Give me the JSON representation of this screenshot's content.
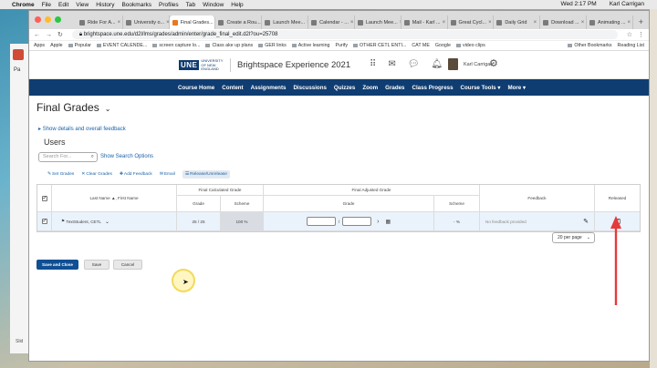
{
  "menubar": {
    "app": "Chrome",
    "items": [
      "File",
      "Edit",
      "View",
      "History",
      "Bookmarks",
      "Profiles",
      "Tab",
      "Window",
      "Help"
    ],
    "clock": "Wed 2:17 PM",
    "user": "Karl Carrigan"
  },
  "tabs": [
    {
      "label": "Ride For A...",
      "active": false
    },
    {
      "label": "University o...",
      "active": false
    },
    {
      "label": "Final Grades...",
      "active": true
    },
    {
      "label": "Create a Rou...",
      "active": false
    },
    {
      "label": "Launch Mee...",
      "active": false
    },
    {
      "label": "Calendar - ...",
      "active": false
    },
    {
      "label": "Launch Mee...",
      "active": false
    },
    {
      "label": "Mail - Karl ...",
      "active": false
    },
    {
      "label": "Great Cycl...",
      "active": false
    },
    {
      "label": "Daily Grid",
      "active": false
    },
    {
      "label": "Download ...",
      "active": false
    },
    {
      "label": "Animating ...",
      "active": false
    }
  ],
  "address": "brightspace.une.edu/d2l/lms/grades/admin/enter/grade_final_edit.d2l?ou=25708",
  "bookmarks": [
    "Apps",
    "Apple",
    "Popular",
    "EVENT CALENDE...",
    "screen capture lo...",
    "Class ake up plans",
    "GER links",
    "Active learning",
    "Purify",
    "OTHER CETL ENTI...",
    "CAT ME",
    "Google",
    "video clips"
  ],
  "bookmarks_right": [
    "Other Bookmarks",
    "Reading List"
  ],
  "site": {
    "logo_text": "UNE",
    "logo_sub": "UNIVERSITY OF NEW ENGLAND",
    "title": "Brightspace Experience 2021",
    "user": "Karl Carrigan"
  },
  "nav": [
    "Course Home",
    "Content",
    "Assignments",
    "Discussions",
    "Quizzes",
    "Zoom",
    "Grades",
    "Class Progress",
    "Course Tools ▾",
    "More ▾"
  ],
  "page": {
    "title": "Final Grades",
    "details_link": "Show details and overall feedback",
    "section": "Users",
    "search_placeholder": "Search For...",
    "search_options": "Show Search Options"
  },
  "actions": [
    "Set Grades",
    "Clear Grades",
    "Add Feedback",
    "Email",
    "Release/Unrelease"
  ],
  "table": {
    "headers": {
      "name": "Last Name ▲, First Name",
      "calc": "Final Calculated Grade",
      "grade": "Grade",
      "scheme": "Scheme",
      "adjusted": "Final Adjusted Grade",
      "adj_grade": "Grade",
      "adj_scheme": "Scheme",
      "feedback": "Feedback",
      "released": "Released"
    },
    "row": {
      "name": "TextStudent, CETL",
      "calc_grade": "25 / 25",
      "calc_scheme": "100 %",
      "adj_sep": "/",
      "adj_scheme": "- %",
      "feedback": "No feedback provided"
    }
  },
  "per_page": "20 per page",
  "buttons": {
    "save_close": "Save and Close",
    "save": "Save",
    "cancel": "Cancel"
  }
}
